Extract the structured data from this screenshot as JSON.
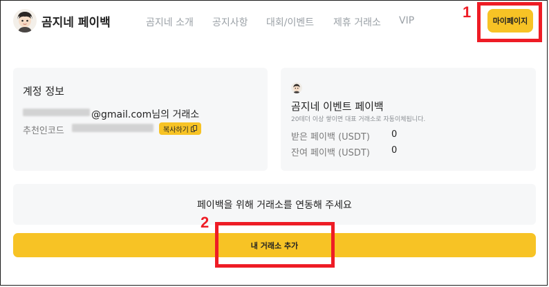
{
  "header": {
    "brand": "곰지네 페이백",
    "nav": [
      "곰지네 소개",
      "공지사항",
      "대회/이벤트",
      "제휴 거래소",
      "VIP"
    ],
    "mypage_label": "마이페이지"
  },
  "annotations": {
    "marker_1": "1",
    "marker_2": "2"
  },
  "account": {
    "title": "계정 정보",
    "email_domain": "@gmail.com",
    "email_suffix": "님의 거래소",
    "referral_label": "추천인코드",
    "copy_label": "복사하기"
  },
  "event": {
    "title": "곰지네 이벤트 페이백",
    "subtitle": "20테더 이상 쌓이면 대표 거래소로 자동이체됩니다.",
    "received_label": "받은 페이백 (USDT)",
    "received_value": "0",
    "balance_label": "잔여 페이백 (USDT)",
    "balance_value": "0"
  },
  "notice": {
    "text": "페이백을 위해 거래소를 연동해 주세요"
  },
  "add_exchange_label": "내 거래소 추가",
  "colors": {
    "accent": "#f7c325",
    "annotation": "#ee1c25",
    "card_bg": "#f6f7f8"
  }
}
